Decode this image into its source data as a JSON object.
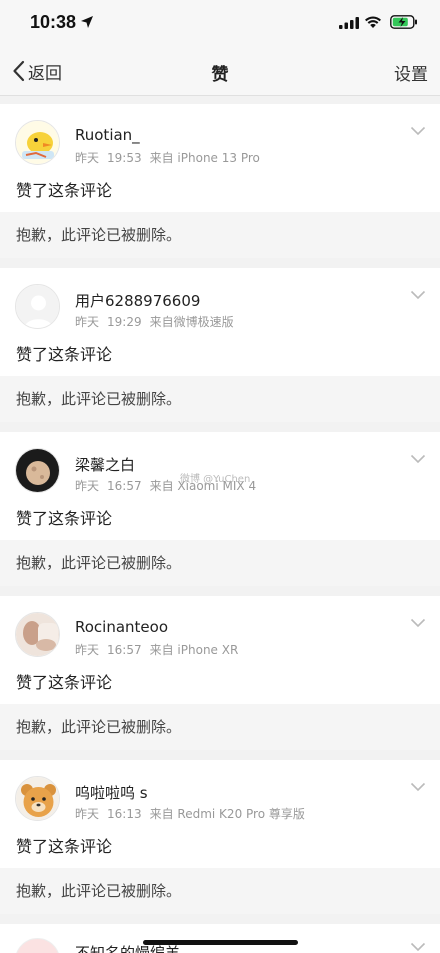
{
  "status_bar": {
    "time": "10:38"
  },
  "nav": {
    "back_label": "返回",
    "title": "赞",
    "settings_label": "设置"
  },
  "items": [
    {
      "username": "Ruotian_",
      "date": "昨天",
      "time": "19:53",
      "source": "来自 iPhone 13 Pro",
      "action": "赞了这条评论",
      "deleted": "抱歉，此评论已被删除。",
      "avatar_icon": "cartoon-duck-avatar"
    },
    {
      "username": "用户6288976609",
      "date": "昨天",
      "time": "19:29",
      "source": "来自微博极速版",
      "action": "赞了这条评论",
      "deleted": "抱歉，此评论已被删除。",
      "avatar_icon": "default-user-avatar"
    },
    {
      "username": "梁馨之白",
      "date": "昨天",
      "time": "16:57",
      "source": "来自 Xiaomi MIX 4",
      "action": "赞了这条评论",
      "deleted": "抱歉，此评论已被删除。",
      "avatar_icon": "moon-avatar"
    },
    {
      "username": "Rocinanteoo",
      "date": "昨天",
      "time": "16:57",
      "source": "来自 iPhone XR",
      "action": "赞了这条评论",
      "deleted": "抱歉，此评论已被删除。",
      "avatar_icon": "photo-avatar"
    },
    {
      "username": "呜啦啦呜 s",
      "date": "昨天",
      "time": "16:13",
      "source": "来自 Redmi K20 Pro 尊享版",
      "action": "赞了这条评论",
      "deleted": "抱歉，此评论已被删除。",
      "avatar_icon": "bear-avatar"
    }
  ],
  "partial_item": {
    "username": "不知名的慢编羊"
  },
  "watermark": "微博 @YuChen"
}
